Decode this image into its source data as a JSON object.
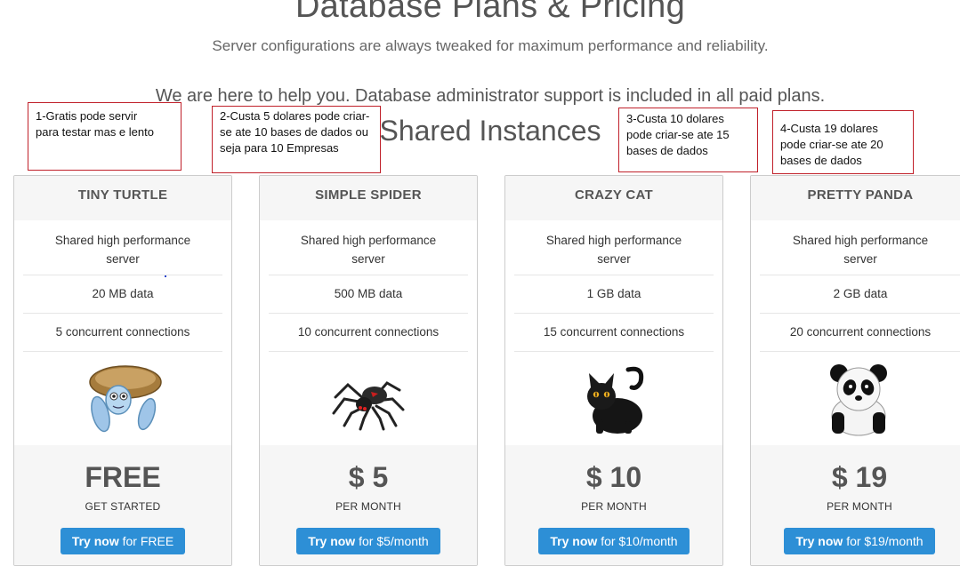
{
  "header": {
    "title": "Database Plans & Pricing",
    "subtitle": "Server configurations are always tweaked for maximum performance and reliability.",
    "support_text": "We are here to help you. Database administrator support is included in all paid plans.",
    "section_title": "Shared Instances"
  },
  "notes": [
    {
      "text": "1-Gratis pode servir para testar mas e lento"
    },
    {
      "text": "2-Custa 5 dolares pode criar-se ate 10 bases de dados ou seja para 10 Empresas"
    },
    {
      "text": "3-Custa 10 dolares pode criar-se ate 15 bases de dados"
    },
    {
      "text": "4-Custa 19 dolares pode criar-se ate 20 bases de dados"
    }
  ],
  "plans": [
    {
      "name": "TINY TURTLE",
      "feature_server": "Shared high performance server",
      "data": "20 MB data",
      "connections": "5 concurrent connections",
      "price": "FREE",
      "period": "GET STARTED",
      "button_strong": "Try now",
      "button_rest": "for FREE",
      "icon": "turtle-icon"
    },
    {
      "name": "SIMPLE SPIDER",
      "feature_server": "Shared high performance server",
      "data": "500 MB data",
      "connections": "10 concurrent connections",
      "price": "$ 5",
      "period": "PER MONTH",
      "button_strong": "Try now",
      "button_rest": "for $5/month",
      "icon": "spider-icon"
    },
    {
      "name": "CRAZY CAT",
      "feature_server": "Shared high performance server",
      "data": "1 GB data",
      "connections": "15 concurrent connections",
      "price": "$ 10",
      "period": "PER MONTH",
      "button_strong": "Try now",
      "button_rest": "for $10/month",
      "icon": "cat-icon"
    },
    {
      "name": "PRETTY PANDA",
      "feature_server": "Shared high performance server",
      "data": "2 GB data",
      "connections": "20 concurrent connections",
      "price": "$ 19",
      "period": "PER MONTH",
      "button_strong": "Try now",
      "button_rest": "for $19/month",
      "icon": "panda-icon"
    }
  ],
  "colors": {
    "button": "#2d8fd6",
    "note_border": "#c0202a"
  }
}
